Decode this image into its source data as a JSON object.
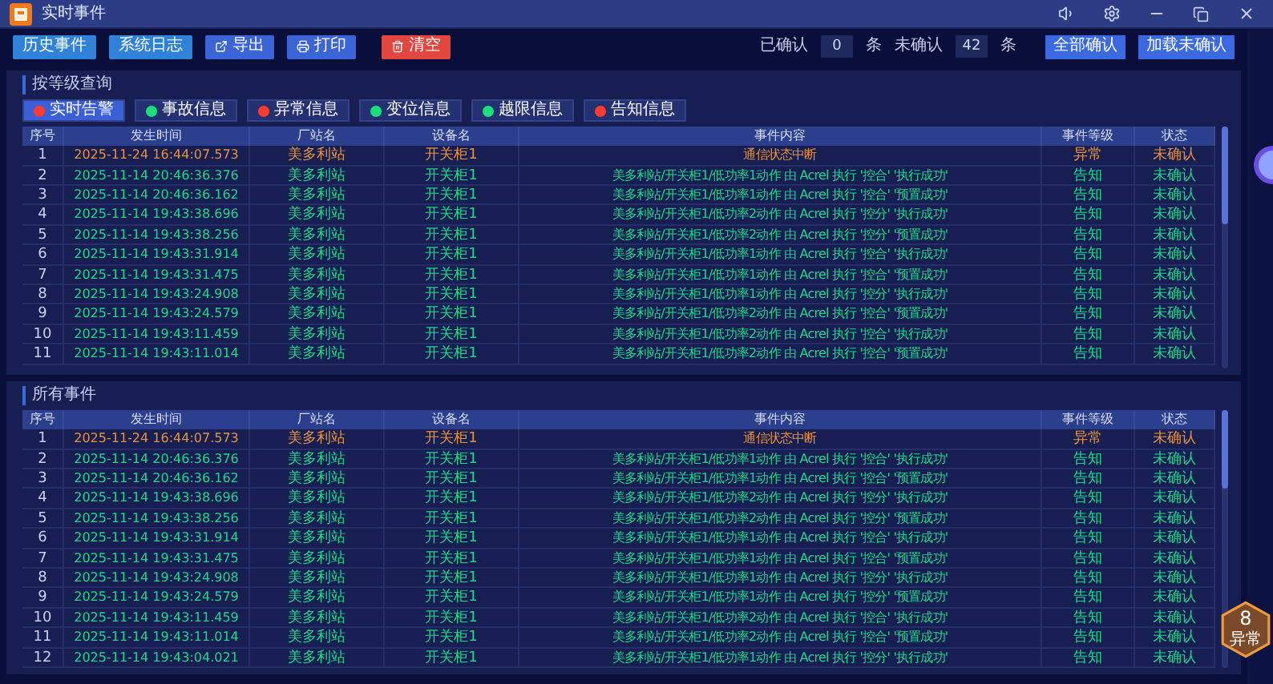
{
  "window": {
    "title": "实时事件"
  },
  "toolbar": {
    "buttons": [
      {
        "label": "历史事件",
        "kind": "plain"
      },
      {
        "label": "系统日志",
        "kind": "plain"
      },
      {
        "label": "导出",
        "kind": "export"
      },
      {
        "label": "打印",
        "kind": "print"
      },
      {
        "label": "清空",
        "kind": "danger"
      }
    ],
    "confirmed": {
      "label": "已确认",
      "value": "0",
      "unit": "条"
    },
    "unconfirmed": {
      "label": "未确认",
      "value": "42",
      "unit": "条"
    },
    "actions": [
      "全部确认",
      "加载未确认"
    ]
  },
  "level_query": {
    "title": "按等级查询",
    "filters": [
      {
        "label": "实时告警",
        "color": "#ff3b30",
        "selected": true
      },
      {
        "label": "事故信息",
        "color": "#19e07a",
        "selected": false
      },
      {
        "label": "异常信息",
        "color": "#ff3b30",
        "selected": false
      },
      {
        "label": "变位信息",
        "color": "#19e07a",
        "selected": false
      },
      {
        "label": "越限信息",
        "color": "#19e07a",
        "selected": false
      },
      {
        "label": "告知信息",
        "color": "#ff3b30",
        "selected": false
      }
    ],
    "table": {
      "columns": [
        "序号",
        "发生时间",
        "厂站名",
        "设备名",
        "事件内容",
        "事件等级",
        "状态"
      ],
      "rows": [
        {
          "no": "1",
          "time": "2025-11-24 16:44:07.573",
          "station": "美多利站",
          "device": "开关柜1",
          "content": "通信状态中断",
          "level": "异常",
          "status": "未确认",
          "kind": "alarm"
        },
        {
          "no": "2",
          "time": "2025-11-14 20:46:36.376",
          "station": "美多利站",
          "device": "开关柜1",
          "content": "美多利站/开关柜1/低功率1动作 由 Acrel 执行 '控合' '执行成功'",
          "level": "告知",
          "status": "未确认",
          "kind": "info"
        },
        {
          "no": "3",
          "time": "2025-11-14 20:46:36.162",
          "station": "美多利站",
          "device": "开关柜1",
          "content": "美多利站/开关柜1/低功率1动作 由 Acrel 执行 '控合' '预置成功'",
          "level": "告知",
          "status": "未确认",
          "kind": "info"
        },
        {
          "no": "4",
          "time": "2025-11-14 19:43:38.696",
          "station": "美多利站",
          "device": "开关柜1",
          "content": "美多利站/开关柜1/低功率2动作 由 Acrel 执行 '控分' '执行成功'",
          "level": "告知",
          "status": "未确认",
          "kind": "info"
        },
        {
          "no": "5",
          "time": "2025-11-14 19:43:38.256",
          "station": "美多利站",
          "device": "开关柜1",
          "content": "美多利站/开关柜1/低功率2动作 由 Acrel 执行 '控分' '预置成功'",
          "level": "告知",
          "status": "未确认",
          "kind": "info"
        },
        {
          "no": "6",
          "time": "2025-11-14 19:43:31.914",
          "station": "美多利站",
          "device": "开关柜1",
          "content": "美多利站/开关柜1/低功率1动作 由 Acrel 执行 '控合' '执行成功'",
          "level": "告知",
          "status": "未确认",
          "kind": "info"
        },
        {
          "no": "7",
          "time": "2025-11-14 19:43:31.475",
          "station": "美多利站",
          "device": "开关柜1",
          "content": "美多利站/开关柜1/低功率1动作 由 Acrel 执行 '控合' '预置成功'",
          "level": "告知",
          "status": "未确认",
          "kind": "info"
        },
        {
          "no": "8",
          "time": "2025-11-14 19:43:24.908",
          "station": "美多利站",
          "device": "开关柜1",
          "content": "美多利站/开关柜1/低功率1动作 由 Acrel 执行 '控分' '执行成功'",
          "level": "告知",
          "status": "未确认",
          "kind": "info"
        },
        {
          "no": "9",
          "time": "2025-11-14 19:43:24.579",
          "station": "美多利站",
          "device": "开关柜1",
          "content": "美多利站/开关柜1/低功率2动作 由 Acrel 执行 '控合' '预置成功'",
          "level": "告知",
          "status": "未确认",
          "kind": "info"
        },
        {
          "no": "10",
          "time": "2025-11-14 19:43:11.459",
          "station": "美多利站",
          "device": "开关柜1",
          "content": "美多利站/开关柜1/低功率2动作 由 Acrel 执行 '控合' '执行成功'",
          "level": "告知",
          "status": "未确认",
          "kind": "info"
        },
        {
          "no": "11",
          "time": "2025-11-14 19:43:11.014",
          "station": "美多利站",
          "device": "开关柜1",
          "content": "美多利站/开关柜1/低功率2动作 由 Acrel 执行 '控合' '预置成功'",
          "level": "告知",
          "status": "未确认",
          "kind": "info"
        }
      ]
    }
  },
  "all_events": {
    "title": "所有事件",
    "table": {
      "columns": [
        "序号",
        "发生时间",
        "厂站名",
        "设备名",
        "事件内容",
        "事件等级",
        "状态"
      ],
      "rows": [
        {
          "no": "1",
          "time": "2025-11-24 16:44:07.573",
          "station": "美多利站",
          "device": "开关柜1",
          "content": "通信状态中断",
          "level": "异常",
          "status": "未确认",
          "kind": "alarm"
        },
        {
          "no": "2",
          "time": "2025-11-14 20:46:36.376",
          "station": "美多利站",
          "device": "开关柜1",
          "content": "美多利站/开关柜1/低功率1动作 由 Acrel 执行 '控合' '执行成功'",
          "level": "告知",
          "status": "未确认",
          "kind": "info"
        },
        {
          "no": "3",
          "time": "2025-11-14 20:46:36.162",
          "station": "美多利站",
          "device": "开关柜1",
          "content": "美多利站/开关柜1/低功率1动作 由 Acrel 执行 '控合' '预置成功'",
          "level": "告知",
          "status": "未确认",
          "kind": "info"
        },
        {
          "no": "4",
          "time": "2025-11-14 19:43:38.696",
          "station": "美多利站",
          "device": "开关柜1",
          "content": "美多利站/开关柜1/低功率2动作 由 Acrel 执行 '控分' '执行成功'",
          "level": "告知",
          "status": "未确认",
          "kind": "info"
        },
        {
          "no": "5",
          "time": "2025-11-14 19:43:38.256",
          "station": "美多利站",
          "device": "开关柜1",
          "content": "美多利站/开关柜1/低功率2动作 由 Acrel 执行 '控分' '预置成功'",
          "level": "告知",
          "status": "未确认",
          "kind": "info"
        },
        {
          "no": "6",
          "time": "2025-11-14 19:43:31.914",
          "station": "美多利站",
          "device": "开关柜1",
          "content": "美多利站/开关柜1/低功率1动作 由 Acrel 执行 '控合' '执行成功'",
          "level": "告知",
          "status": "未确认",
          "kind": "info"
        },
        {
          "no": "7",
          "time": "2025-11-14 19:43:31.475",
          "station": "美多利站",
          "device": "开关柜1",
          "content": "美多利站/开关柜1/低功率1动作 由 Acrel 执行 '控合' '预置成功'",
          "level": "告知",
          "status": "未确认",
          "kind": "info"
        },
        {
          "no": "8",
          "time": "2025-11-14 19:43:24.908",
          "station": "美多利站",
          "device": "开关柜1",
          "content": "美多利站/开关柜1/低功率1动作 由 Acrel 执行 '控分' '执行成功'",
          "level": "告知",
          "status": "未确认",
          "kind": "info"
        },
        {
          "no": "9",
          "time": "2025-11-14 19:43:24.579",
          "station": "美多利站",
          "device": "开关柜1",
          "content": "美多利站/开关柜1/低功率1动作 由 Acrel 执行 '控分' '预置成功'",
          "level": "告知",
          "status": "未确认",
          "kind": "info"
        },
        {
          "no": "10",
          "time": "2025-11-14 19:43:11.459",
          "station": "美多利站",
          "device": "开关柜1",
          "content": "美多利站/开关柜1/低功率2动作 由 Acrel 执行 '控合' '执行成功'",
          "level": "告知",
          "status": "未确认",
          "kind": "info"
        },
        {
          "no": "11",
          "time": "2025-11-14 19:43:11.014",
          "station": "美多利站",
          "device": "开关柜1",
          "content": "美多利站/开关柜1/低功率2动作 由 Acrel 执行 '控合' '预置成功'",
          "level": "告知",
          "status": "未确认",
          "kind": "info"
        },
        {
          "no": "12",
          "time": "2025-11-14 19:43:04.021",
          "station": "美多利站",
          "device": "开关柜1",
          "content": "美多利站/开关柜1/低功率1动作 由 Acrel 执行 '控分' '执行成功'",
          "level": "告知",
          "status": "未确认",
          "kind": "info"
        }
      ]
    }
  },
  "badge": {
    "count": "8",
    "label": "异常"
  }
}
